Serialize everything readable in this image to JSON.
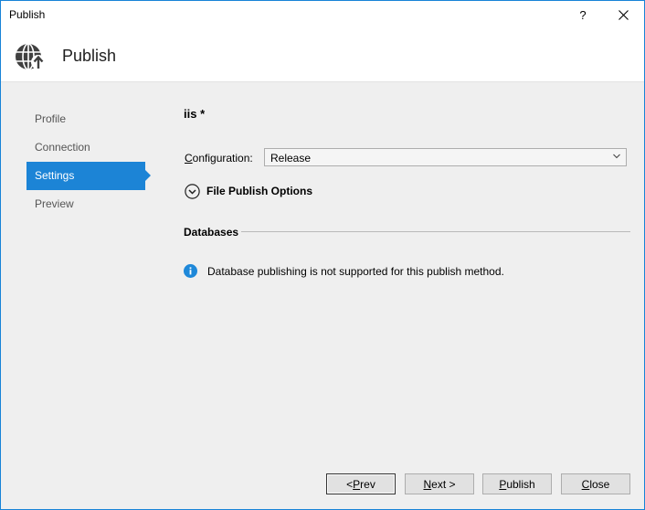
{
  "window": {
    "title": "Publish",
    "help_label": "?"
  },
  "header": {
    "title": "Publish",
    "icon": "globe-publish-icon"
  },
  "nav": {
    "items": [
      {
        "label": "Profile",
        "active": false
      },
      {
        "label": "Connection",
        "active": false
      },
      {
        "label": "Settings",
        "active": true
      },
      {
        "label": "Preview",
        "active": false
      }
    ]
  },
  "settings": {
    "profile_name": "iis *",
    "configuration": {
      "label_mnemonic": "C",
      "label_rest": "onfiguration:",
      "value": "Release"
    },
    "file_publish_options": "File Publish Options",
    "databases_heading": "Databases",
    "info_message": "Database publishing is not supported for this publish method."
  },
  "buttons": {
    "prev": {
      "pre": "< ",
      "mnemonic": "P",
      "post": "rev"
    },
    "next": {
      "pre": "",
      "mnemonic": "N",
      "post": "ext >"
    },
    "publish": {
      "pre": "",
      "mnemonic": "P",
      "post": "ublish"
    },
    "close": {
      "pre": "",
      "mnemonic": "C",
      "post": "lose"
    }
  },
  "colors": {
    "accent": "#1c84d6",
    "window_border": "#1883d7",
    "content_bg": "#efefef",
    "info_blue": "#1e88d9"
  }
}
